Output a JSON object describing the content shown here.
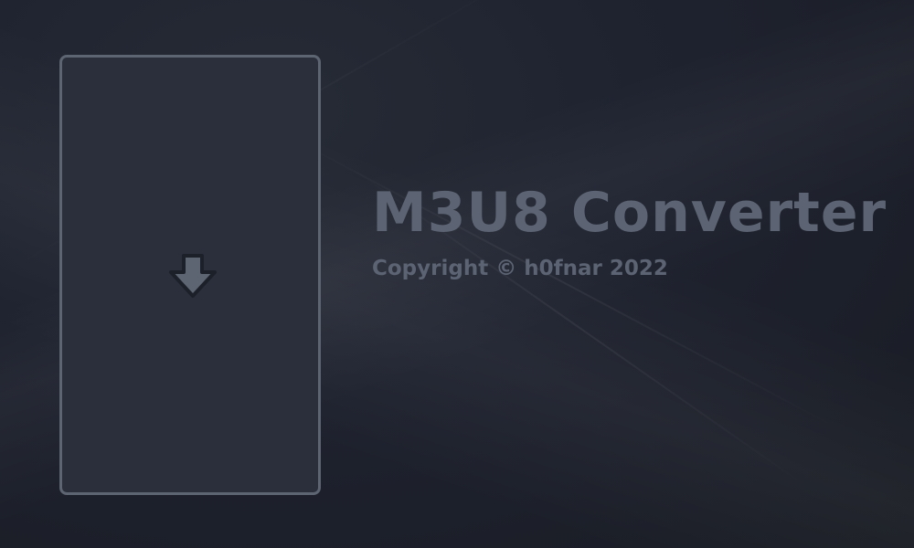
{
  "app": {
    "title": "M3U8 Converter",
    "copyright": "Copyright © h0fnar 2022"
  },
  "drop_zone": {
    "icon": "download-arrow-icon"
  },
  "colors": {
    "background": "#1b1f27",
    "panel": "#2a2f3b",
    "panel_border": "#5d6472",
    "text": "#5c6372"
  }
}
